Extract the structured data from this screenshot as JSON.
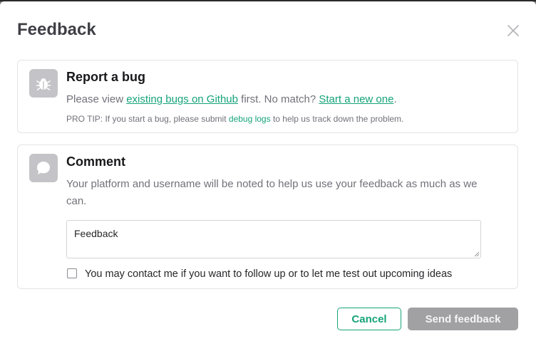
{
  "dialog": {
    "title": "Feedback",
    "close_icon": "close-icon"
  },
  "bug_card": {
    "icon": "bug-icon",
    "title": "Report a bug",
    "text_before": "Please view ",
    "link_existing": "existing bugs on Github",
    "text_middle": " first. No match? ",
    "link_new": "Start a new one",
    "text_after": ".",
    "protip_before": "PRO TIP: If you start a bug, please submit ",
    "protip_link": "debug logs",
    "protip_after": " to help us track down the problem."
  },
  "comment_card": {
    "icon": "speech-bubble-icon",
    "title": "Comment",
    "description": "Your platform and username will be noted to help us use your feedback as much as we can.",
    "textarea_value": "Feedback",
    "checkbox_label": "You may contact me if you want to follow up or to let me test out upcoming ideas",
    "checkbox_checked": false
  },
  "actions": {
    "cancel_label": "Cancel",
    "send_label": "Send feedback"
  },
  "colors": {
    "accent": "#16a37a",
    "disabled_button": "#a1a1a4",
    "icon_bg": "#c4c4c8"
  }
}
